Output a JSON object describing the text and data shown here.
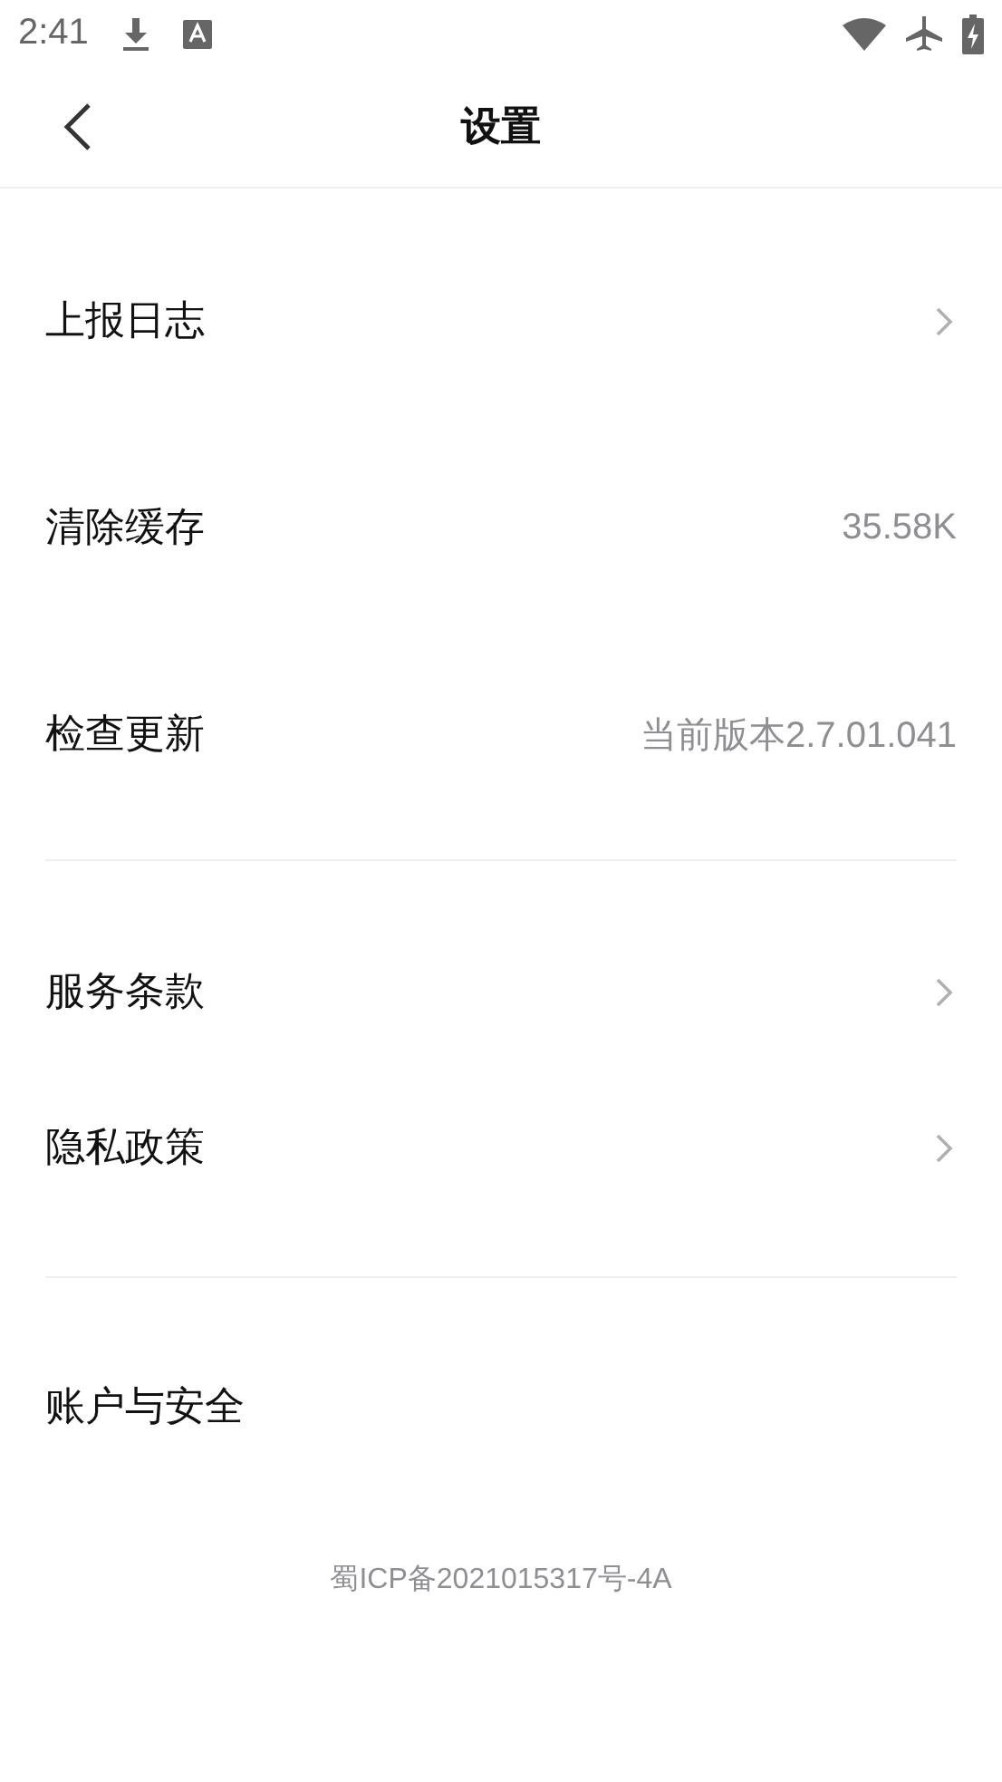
{
  "status_bar": {
    "time": "2:41"
  },
  "header": {
    "title": "设置"
  },
  "groups": [
    {
      "items": [
        {
          "label": "上报日志",
          "kind": "link"
        },
        {
          "label": "清除缓存",
          "kind": "value",
          "value": "35.58K"
        },
        {
          "label": "检查更新",
          "kind": "value",
          "value": "当前版本2.7.01.041"
        }
      ]
    },
    {
      "items": [
        {
          "label": "服务条款",
          "kind": "link"
        },
        {
          "label": "隐私政策",
          "kind": "link"
        }
      ]
    },
    {
      "items": [
        {
          "label": "账户与安全",
          "kind": "plain"
        }
      ]
    }
  ],
  "footer": "蜀ICP备2021015317号-4A"
}
